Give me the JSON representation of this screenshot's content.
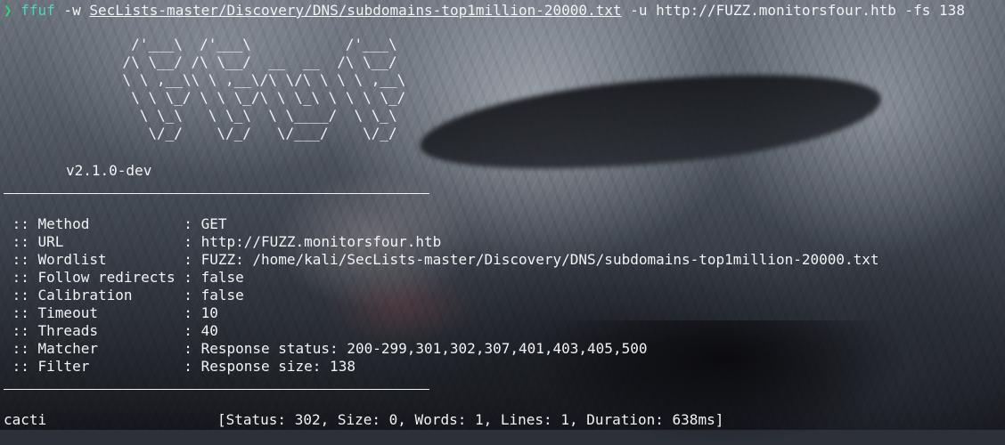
{
  "prompt": {
    "arrow": "❯",
    "command": "ffuf",
    "flag_w": "-w",
    "wordlist_arg": "SecLists-master/Discovery/DNS/subdomains-top1million-20000.txt",
    "flag_u": "-u",
    "url_arg": "http://FUZZ.monitorsfour.htb",
    "flag_fs": "-fs",
    "fs_value": "138"
  },
  "banner": {
    "ascii": "        /'___\\  /'___\\           /'___\\       \n       /\\ \\__/ /\\ \\__/  __  __  /\\ \\__/       \n       \\ \\ ,__\\\\ \\ ,__\\/\\ \\/\\ \\ \\ \\ ,__\\      \n        \\ \\ \\_/ \\ \\ \\_/\\ \\ \\_\\ \\ \\ \\ \\_/      \n         \\ \\_\\   \\ \\_\\  \\ \\____/  \\ \\_\\       \n          \\/_/    \\/_/   \\/___/    \\/_/       ",
    "version": "v2.1.0-dev"
  },
  "config": [
    {
      "key": " :: Method           ",
      "value": ": GET"
    },
    {
      "key": " :: URL              ",
      "value": ": http://FUZZ.monitorsfour.htb"
    },
    {
      "key": " :: Wordlist         ",
      "value": ": FUZZ: /home/kali/SecLists-master/Discovery/DNS/subdomains-top1million-20000.txt"
    },
    {
      "key": " :: Follow redirects ",
      "value": ": false"
    },
    {
      "key": " :: Calibration      ",
      "value": ": false"
    },
    {
      "key": " :: Timeout          ",
      "value": ": 10"
    },
    {
      "key": " :: Threads          ",
      "value": ": 40"
    },
    {
      "key": " :: Matcher          ",
      "value": ": Response status: 200-299,301,302,307,401,403,405,500"
    },
    {
      "key": " :: Filter           ",
      "value": ": Response size: 138"
    }
  ],
  "results": [
    {
      "word": "cacti",
      "info": "[Status: 302, Size: 0, Words: 1, Lines: 1, Duration: 638ms]"
    }
  ],
  "colors": {
    "prompt_arrow": "#2fd47a",
    "command": "#4cd6c0",
    "text": "#f1f3f5"
  }
}
